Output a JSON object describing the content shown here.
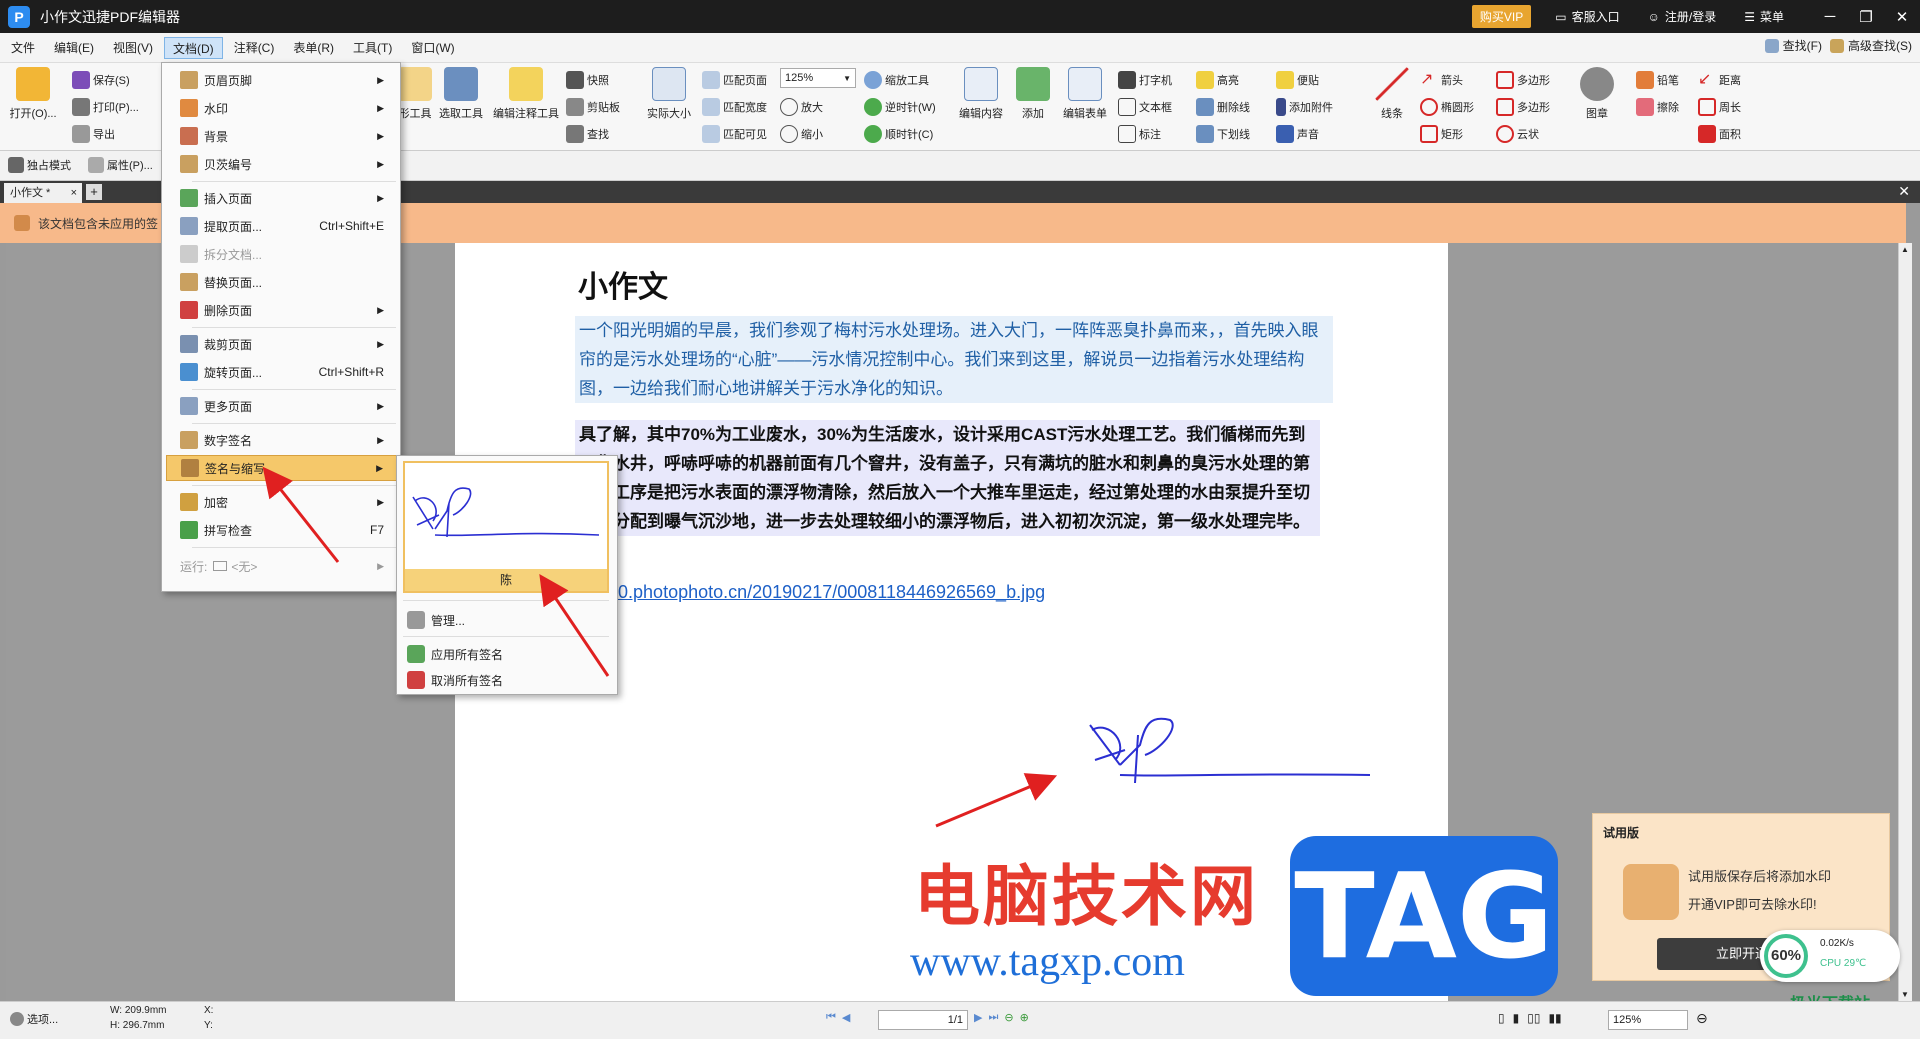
{
  "app": {
    "title": "小作文迅捷PDF编辑器",
    "vip_label": "购买VIP",
    "service_label": "客服入口",
    "login_label": "注册/登录",
    "menu_label": "菜单"
  },
  "menubar": {
    "items": [
      "文件",
      "编辑(E)",
      "视图(V)",
      "文档(D)",
      "注释(C)",
      "表单(R)",
      "工具(T)",
      "窗口(W)"
    ],
    "find_label": "查找(F)",
    "adv_find_label": "高级查找(S)"
  },
  "toolbar": {
    "open": "打开(O)...",
    "save": "保存(S)",
    "print": "打印(P)...",
    "export": "导出",
    "hand_tool": "形工具",
    "select_tool": "选取工具",
    "edit_annot": "编辑注释工具",
    "snapshot": "快照",
    "clipboard": "剪贴板",
    "find": "查找",
    "actual_size": "实际大小",
    "fit_page": "匹配页面",
    "fit_width": "匹配宽度",
    "fit_visible": "匹配可见",
    "zoom_value": "125%",
    "zoom_tool": "缩放工具",
    "zoom_in": "放大",
    "zoom_out": "缩小",
    "rotate_ccw": "逆时针(W)",
    "rotate_cw": "顺时针(C)",
    "edit_content": "编辑内容",
    "add": "添加",
    "edit_form": "编辑表单",
    "typewriter": "打字机",
    "textbox": "文本框",
    "callout": "标注",
    "highlight": "高亮",
    "strikethrough": "删除线",
    "underline": "下划线",
    "note": "便贴",
    "attach": "添加附件",
    "sound": "声音",
    "line": "线条",
    "arrow": "箭头",
    "ellipse": "椭圆形",
    "rect": "矩形",
    "polygon": "多边形",
    "polyline": "多边形",
    "cloud": "云状",
    "stamp": "图章",
    "pencil": "铅笔",
    "eraser": "擦除",
    "distance": "距离",
    "perimeter": "周长",
    "area": "面积",
    "exclusive_mode": "独占模式",
    "properties": "属性(P)..."
  },
  "tabs": {
    "doc_tab": "小作文 *"
  },
  "notice": {
    "text": "该文档包含未应用的签"
  },
  "document": {
    "title": "小作文",
    "para1": "一个阳光明媚的早晨，我们参观了梅村污水处理场。进入大门，一阵阵恶臭扑鼻而来，，首先映入眼帘的是污水处理场的“心脏”——污水情况控制中心。我们来到这里，解说员一边指着污水处理结构图，一边给我们耐心地讲解关于污水净化的知识。",
    "para2": "具了解，其中70%为工业废水，30%为生活废水，设计采用CAST污水处理工艺。我们循梯而先到了集水井，呼哧呼哧的机器前面有几个窨井，没有盖子，只有满坑的脏水和刺鼻的臭污水处理的第一道工序是把污水表面的漂浮物清除，然后放入一个大推车里运走，经过第处理的水由泵提升至切换井分配到曝气沉沙地，进一步去处理较细小的漂浮物后，进入初初次沉淀，第一级水处理完毕。",
    "link": "//pic50.photophoto.cn/20190217/0008118446926569_b.jpg"
  },
  "doc_menu": {
    "items": [
      {
        "label": "页眉页脚",
        "shortcut": "",
        "submenu": true
      },
      {
        "label": "水印",
        "shortcut": "",
        "submenu": true
      },
      {
        "label": "背景",
        "shortcut": "",
        "submenu": true
      },
      {
        "label": "贝茨编号",
        "shortcut": "",
        "submenu": true
      },
      {
        "label": "插入页面",
        "shortcut": "",
        "submenu": true
      },
      {
        "label": "提取页面...",
        "shortcut": "Ctrl+Shift+E",
        "submenu": false
      },
      {
        "label": "拆分文档...",
        "shortcut": "",
        "submenu": false
      },
      {
        "label": "替换页面...",
        "shortcut": "",
        "submenu": false
      },
      {
        "label": "删除页面",
        "shortcut": "",
        "submenu": true
      },
      {
        "label": "裁剪页面",
        "shortcut": "",
        "submenu": true
      },
      {
        "label": "旋转页面...",
        "shortcut": "Ctrl+Shift+R",
        "submenu": false
      },
      {
        "label": "更多页面",
        "shortcut": "",
        "submenu": true
      },
      {
        "label": "数字签名",
        "shortcut": "",
        "submenu": true
      },
      {
        "label": "签名与缩写",
        "shortcut": "",
        "submenu": true
      },
      {
        "label": "加密",
        "shortcut": "",
        "submenu": true
      },
      {
        "label": "拼写检查",
        "shortcut": "F7",
        "submenu": false
      },
      {
        "label": "运行:",
        "shortcut": "<无>",
        "submenu": true
      }
    ]
  },
  "sig_submenu": {
    "signature_name": "陈",
    "manage": "管理...",
    "apply_all": "应用所有签名",
    "cancel_all": "取消所有签名"
  },
  "statusbar": {
    "options": "选项...",
    "width": "W: 209.9mm",
    "height": "H: 296.7mm",
    "x": "X:",
    "y": "Y:",
    "page": "1/1",
    "zoom": "125%"
  },
  "trial": {
    "title": "试用版",
    "line1": "试用版保存后将添加水印",
    "line2": "开通VIP即可去除水印!",
    "button": "立即开通"
  },
  "perf": {
    "percent": "60%",
    "speed": "0.02K/s",
    "cpu": "CPU 29℃"
  },
  "watermark": {
    "cn": "电脑技术网",
    "url": "www.tagxp.com",
    "tag": "TAG",
    "corner": "极光下载站"
  },
  "colors": {
    "menu_highlight": "#f5c86a",
    "notice_bg": "#f7b98a",
    "link": "#1d60c7",
    "arrow": "#e02020"
  }
}
